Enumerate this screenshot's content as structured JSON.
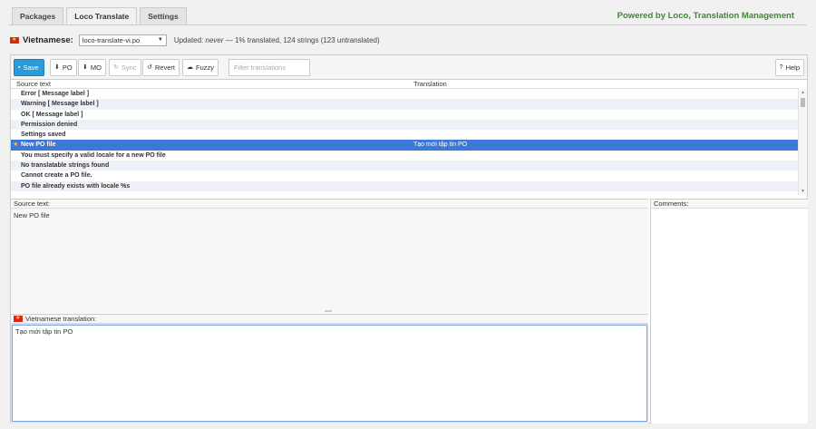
{
  "tabs": [
    "Packages",
    "Loco Translate",
    "Settings"
  ],
  "powered_by": "Powered by Loco, Translation Management",
  "locale": {
    "name": "Vietnamese:",
    "file": "loco-translate-vi.po",
    "status_prefix": "Updated: ",
    "status_never": "never",
    "status_suffix": " — 1% translated, 124 strings (123 untranslated)"
  },
  "toolbar": {
    "save": "Save",
    "po": "PO",
    "mo": "MO",
    "sync": "Sync",
    "revert": "Revert",
    "fuzzy": "Fuzzy",
    "filter_placeholder": "Filter translations",
    "help": "Help"
  },
  "grid": {
    "col_source": "Source text",
    "col_translation": "Translation",
    "rows": [
      {
        "source": "Error [ Message label ]",
        "translation": ""
      },
      {
        "source": "Warning [ Message label ]",
        "translation": ""
      },
      {
        "source": "OK [ Message label ]",
        "translation": ""
      },
      {
        "source": "Permission denied",
        "translation": ""
      },
      {
        "source": "Settings saved",
        "translation": ""
      },
      {
        "source": "New PO file",
        "translation": "Tạo mới tập tin PO",
        "selected": true
      },
      {
        "source": "You must specify a valid locale for a new PO file",
        "translation": ""
      },
      {
        "source": "No translatable strings found",
        "translation": ""
      },
      {
        "source": "Cannot create a PO file.",
        "translation": ""
      },
      {
        "source": "PO file already exists with locale %s",
        "translation": ""
      }
    ]
  },
  "source_pane": {
    "label": "Source text:",
    "text": "New PO file"
  },
  "translation_pane": {
    "label": "Vietnamese translation:",
    "text": "Tạo mới tập tin PO"
  },
  "comments_pane": {
    "label": "Comments:"
  },
  "colors": {
    "accent": "#2a9bd6",
    "selected_row": "#3b78d8",
    "brand_green": "#3c8a2e",
    "flag_red": "#da251d"
  }
}
